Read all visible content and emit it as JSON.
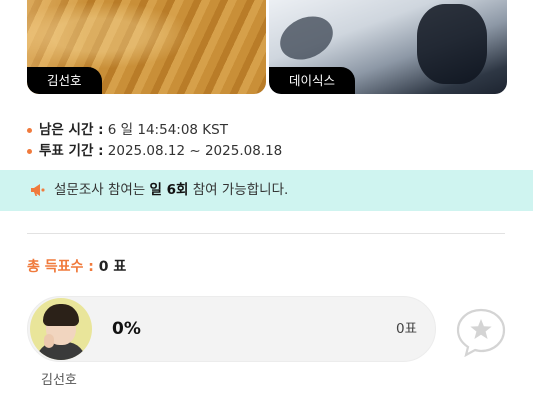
{
  "cards": [
    {
      "name": "김선호"
    },
    {
      "name": "데이식스"
    }
  ],
  "info": {
    "remaining_label": "남은 시간 :",
    "remaining_value": "6 일 14:54:08 KST",
    "period_label": "투표 기간 :",
    "period_value": "2025.08.12 ~ 2025.08.18"
  },
  "notice": {
    "prefix": "설문조사 참여는 ",
    "highlight": "일 6회",
    "suffix": " 참여 가능합니다."
  },
  "total": {
    "label": "총 득표수 :",
    "value": "0 표"
  },
  "candidates": [
    {
      "name": "김선호",
      "percent": "0%",
      "votes": "0표"
    }
  ],
  "icons": {
    "notice": "megaphone-icon",
    "vote": "star-speech-bubble-icon"
  },
  "colors": {
    "accent": "#f07a3c",
    "notice_bg": "#cff4f0",
    "bar_bg": "#f3f3f3"
  }
}
